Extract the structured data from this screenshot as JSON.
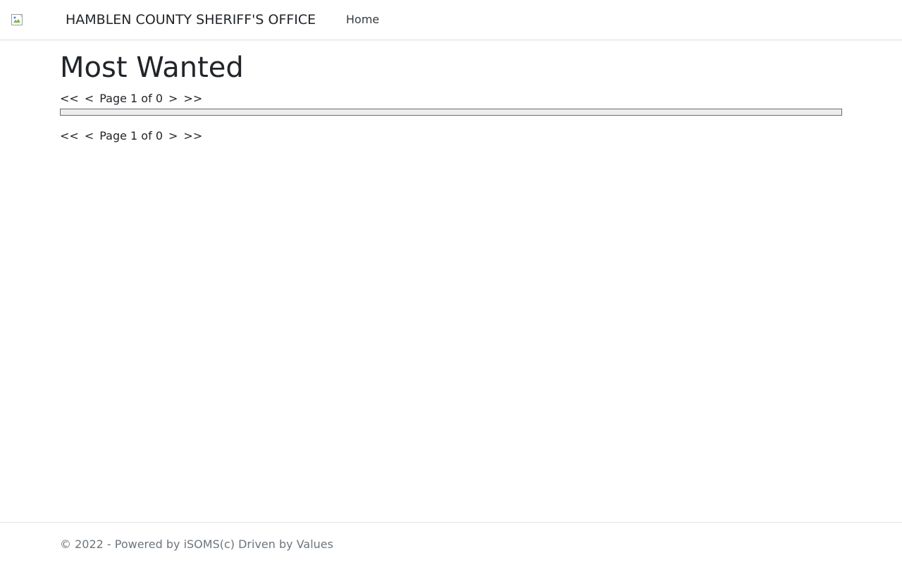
{
  "header": {
    "brand": "HAMBLEN COUNTY SHERIFF'S OFFICE",
    "nav": {
      "home": "Home"
    },
    "logo_icon": "broken-image-icon"
  },
  "main": {
    "title": "Most Wanted",
    "pager_top": {
      "first": "<<",
      "prev": "<",
      "status": "Page 1 of 0",
      "next": ">",
      "last": ">>"
    },
    "pager_bottom": {
      "first": "<<",
      "prev": "<",
      "status": "Page 1 of 0",
      "next": ">",
      "last": ">>"
    }
  },
  "footer": {
    "text": "© 2022 - Powered by iSOMS(c) Driven by Values"
  },
  "colors": {
    "text": "#212529",
    "muted": "#6c757d",
    "border": "#e5e5e5",
    "results_box_fill": "#ededed",
    "results_box_border": "#6c6c6c"
  }
}
